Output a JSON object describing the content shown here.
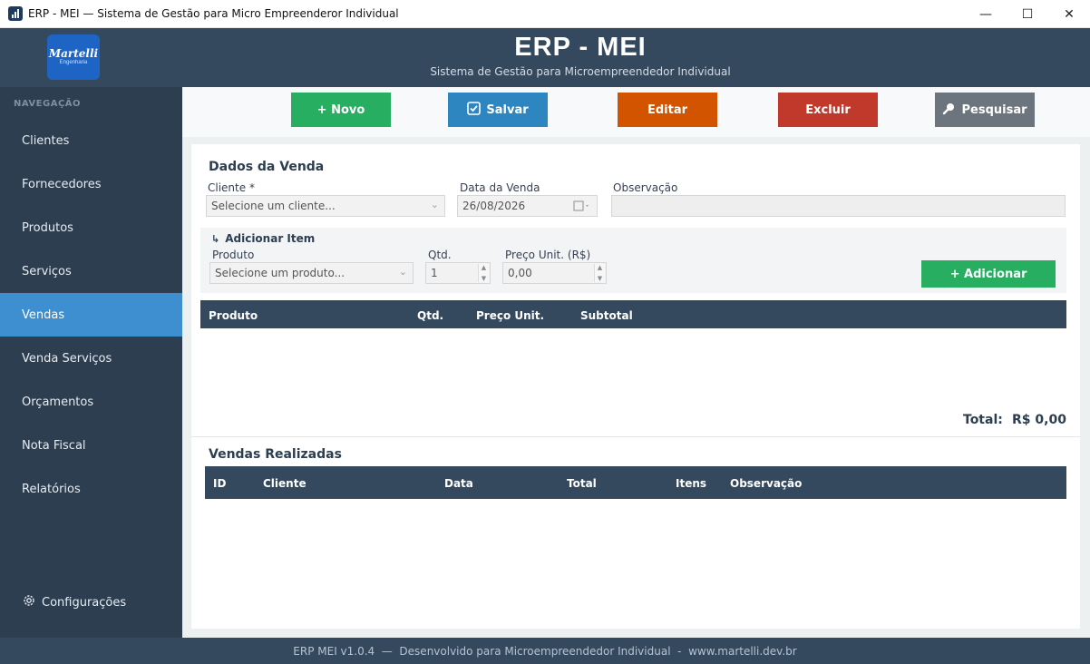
{
  "window": {
    "title": "ERP - MEI — Sistema de Gestão para Micro Empreenderor Individual",
    "controls": {
      "minimize": "—",
      "maximize": "☐",
      "close": "✕"
    }
  },
  "header": {
    "logo_line1": "Martelli",
    "logo_line2": "Engenharia",
    "title": "ERP - MEI",
    "subtitle": "Sistema de Gestão para Microempreendedor Individual"
  },
  "sidebar": {
    "heading": "NAVEGAÇÃO",
    "items": [
      {
        "label": "Clientes"
      },
      {
        "label": "Fornecedores"
      },
      {
        "label": "Produtos"
      },
      {
        "label": "Serviços"
      },
      {
        "label": "Vendas",
        "active": true
      },
      {
        "label": "Venda Serviços"
      },
      {
        "label": "Orçamentos"
      },
      {
        "label": "Nota Fiscal"
      },
      {
        "label": "Relatórios"
      }
    ],
    "settings_label": "Configurações"
  },
  "toolbar": {
    "novo": "+ Novo",
    "salvar": "Salvar",
    "editar": "Editar",
    "excluir": "Excluir",
    "pesquisar": "Pesquisar"
  },
  "venda": {
    "section_title": "Dados da Venda",
    "cliente_label": "Cliente *",
    "cliente_value": "Selecione um cliente...",
    "data_label": "Data da Venda",
    "data_value": "26/08/2026",
    "obs_label": "Observação",
    "obs_value": ""
  },
  "item": {
    "section_title": "Adicionar Item",
    "produto_label": "Produto",
    "produto_value": "Selecione um produto...",
    "qtd_label": "Qtd.",
    "qtd_value": "1",
    "preco_label": "Preço Unit. (R$)",
    "preco_value": "0,00",
    "add_button": "+ Adicionar"
  },
  "items_table": {
    "columns": [
      "Produto",
      "Qtd.",
      "Preço Unit.",
      "Subtotal"
    ],
    "rows": []
  },
  "total": {
    "label": "Total:",
    "value": "R$ 0,00"
  },
  "vendas_table": {
    "section_title": "Vendas Realizadas",
    "columns": [
      "ID",
      "Cliente",
      "Data",
      "Total",
      "Itens",
      "Observação"
    ],
    "rows": []
  },
  "footer": {
    "text": "ERP MEI v1.0.4  —  Desenvolvido para Microempreendedor Individual  -  www.martelli.dev.br"
  },
  "colors": {
    "header": "#34495e",
    "sidebar": "#2c3e50",
    "active": "#3d8fcf",
    "green": "#27ae60",
    "blue": "#2e86c1",
    "orange": "#d35400",
    "red": "#c0392b",
    "gray": "#6c757d"
  }
}
